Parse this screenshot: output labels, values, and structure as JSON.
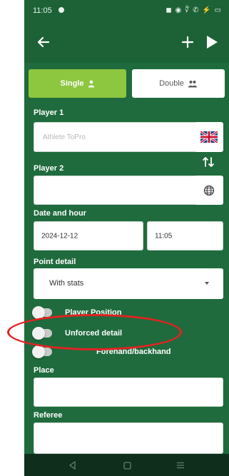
{
  "status_bar": {
    "time": "11:05",
    "system_icons": "◼ ◉ ∜ ✆ ⚡ ▭"
  },
  "app_bar": {
    "icons": [
      "back-arrow-icon",
      "plus-icon",
      "play-icon"
    ]
  },
  "tabs": [
    {
      "label": "Single",
      "icon": "single-player-icon",
      "selected": true
    },
    {
      "label": "Double",
      "icon": "double-player-icon",
      "selected": false
    }
  ],
  "player1": {
    "label": "Player 1",
    "placeholder": "Athlete ToPro",
    "flag": "uk-flag-icon"
  },
  "player2": {
    "label": "Player 2",
    "value": "",
    "globe_icon": "globe-icon"
  },
  "swap_icon": "swap-vertical-icon",
  "date_hour": {
    "label": "Date and hour",
    "date": "2024-12-12",
    "time": "11:05"
  },
  "point_detail": {
    "label": "Point detail",
    "value": "With stats"
  },
  "toggles": [
    {
      "label": "Player Position",
      "on": false
    },
    {
      "label": "Unforced detail",
      "on": false
    },
    {
      "label": "Forehand/backhand",
      "on": false
    }
  ],
  "place": {
    "label": "Place",
    "value": ""
  },
  "referee": {
    "label": "Referee",
    "value": ""
  },
  "nav_bar": {
    "icons": [
      "back-triangle-icon",
      "home-square-icon",
      "menu-lines-icon"
    ]
  },
  "colors": {
    "background": "#1f6b3d",
    "appbar": "#1c6236",
    "accent": "#8dc63f",
    "annotation": "#e32222"
  }
}
